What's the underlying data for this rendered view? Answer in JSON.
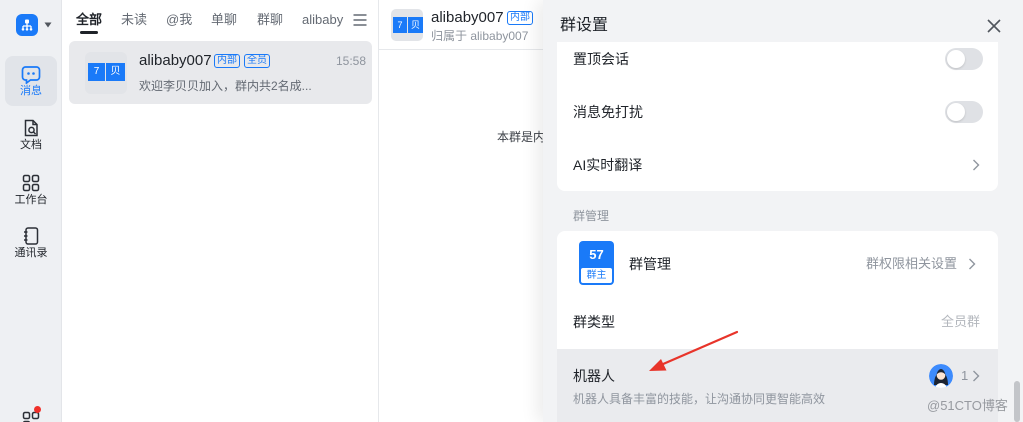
{
  "theme": {
    "accent": "#1a7af8",
    "annotation": "#e8342a",
    "unread_dot": "#f0302a"
  },
  "sidebar": {
    "logo_icon": "org-icon",
    "items": [
      {
        "label": "消息",
        "icon": "message-icon",
        "active": true
      },
      {
        "label": "文档",
        "icon": "document-icon",
        "active": false
      },
      {
        "label": "工作台",
        "icon": "workbench-icon",
        "active": false
      },
      {
        "label": "通讯录",
        "icon": "contacts-icon",
        "active": false
      }
    ],
    "bottom_icon": "apps-icon",
    "bottom_icon_has_dot": true
  },
  "chat_list": {
    "tabs": [
      {
        "label": "全部",
        "active": true
      },
      {
        "label": "未读",
        "active": false
      },
      {
        "label": "@我",
        "active": false
      },
      {
        "label": "单聊",
        "active": false
      },
      {
        "label": "群聊",
        "active": false
      },
      {
        "label": "alibaby",
        "active": false
      }
    ],
    "menu_icon": "menu-icon",
    "items": [
      {
        "avatar": [
          "7",
          "贝"
        ],
        "name": "alibaby007",
        "badges": [
          "内部",
          "全员"
        ],
        "time": "15:58",
        "preview": "欢迎李贝贝加入，群内共2名成...",
        "selected": true
      }
    ]
  },
  "chat": {
    "header": {
      "avatar": [
        "7",
        "贝"
      ],
      "name": "alibaby007",
      "badge": "内部",
      "subtitle": "归属于 alibaby007"
    },
    "notice": "本群是内"
  },
  "group_settings": {
    "title": "群设置",
    "close_icon": "close-icon",
    "general": [
      {
        "label": "置顶会话",
        "toggle_on": false
      },
      {
        "label": "消息免打扰",
        "toggle_on": false
      },
      {
        "label": "AI实时翻译"
      }
    ],
    "management_section": "群管理",
    "admin": {
      "label": "群管理",
      "avatar_number": "57",
      "avatar_role": "群主",
      "value": "群权限相关设置"
    },
    "group_type": {
      "label": "群类型",
      "value": "全员群"
    },
    "robot": {
      "label": "机器人",
      "description": "机器人具备丰富的技能，让沟通协同更智能高效",
      "count": "1",
      "avatar_icon": "robot-avatar-icon",
      "hovered": true
    }
  },
  "watermark": "@51CTO博客"
}
